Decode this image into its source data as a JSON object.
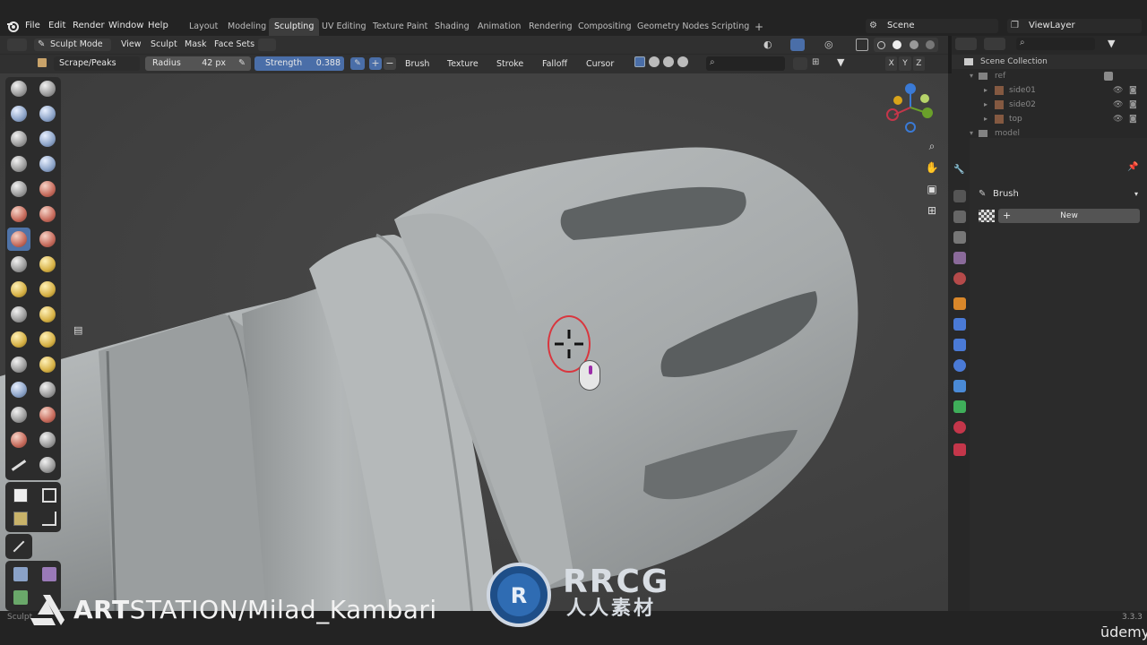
{
  "topbar": {
    "menus": [
      "File",
      "Edit",
      "Render",
      "Window",
      "Help"
    ],
    "workspaces": [
      "Layout",
      "Modeling",
      "Sculpting",
      "UV Editing",
      "Texture Paint",
      "Shading",
      "Animation",
      "Rendering",
      "Compositing",
      "Geometry Nodes",
      "Scripting"
    ],
    "active_workspace": "Sculpting",
    "add_tab": "+",
    "scene": "Scene",
    "view_layer": "ViewLayer"
  },
  "header": {
    "mode": "Sculpt Mode",
    "menus": [
      "View",
      "Sculpt",
      "Mask",
      "Face Sets"
    ]
  },
  "toolsettings": {
    "brush_name": "Scrape/Peaks",
    "radius_label": "Radius",
    "radius_value": "42 px",
    "strength_label": "Strength",
    "strength_value": "0.388",
    "plus": "+",
    "minus": "−",
    "dropdowns": [
      "Brush",
      "Texture",
      "Stroke",
      "Falloff",
      "Cursor"
    ],
    "axes": [
      "X",
      "Y",
      "Z"
    ]
  },
  "outliner": {
    "title": "Scene Collection",
    "items": [
      "ref",
      "side01",
      "side02",
      "top",
      "model"
    ]
  },
  "properties": {
    "panel_title": "Brush",
    "new_button": "New"
  },
  "overlay": {
    "watermark_bold": "ART",
    "watermark_rest": "STATION/Milad_Kambari",
    "rrcg": "RRCG",
    "rrcg_sub": "人人素材",
    "udemy": "ūdemy",
    "version": "3.3.3",
    "status_left": "Sculpt"
  },
  "colors": {
    "accent": "#4a6ea8",
    "cursor_ring": "#d9363e",
    "model": "#a9adae"
  }
}
